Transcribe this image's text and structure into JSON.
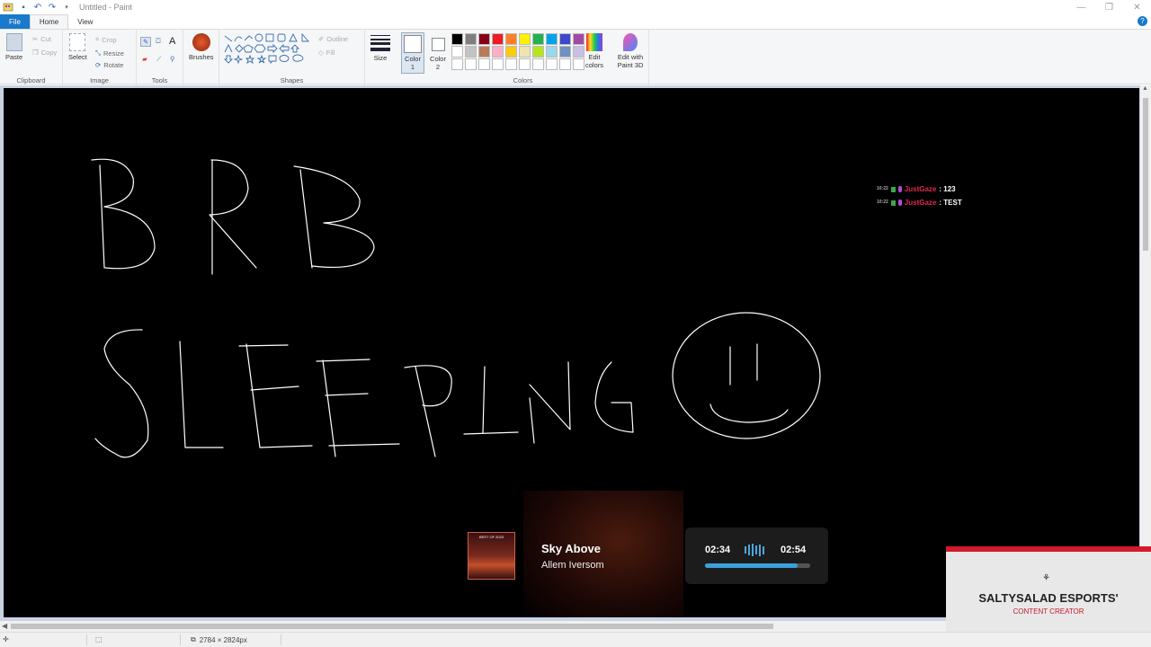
{
  "window": {
    "title": "Untitled - Paint",
    "controls": [
      "—",
      "❐",
      "✕"
    ]
  },
  "tabs": [
    "File",
    "Home",
    "View"
  ],
  "ribbon": {
    "clipboard": {
      "label": "Clipboard",
      "paste": "Paste",
      "cut": "Cut",
      "copy": "Copy"
    },
    "image": {
      "label": "Image",
      "select": "Select",
      "crop": "Crop",
      "resize": "Resize",
      "rotate": "Rotate"
    },
    "tools": {
      "label": "Tools"
    },
    "brushes": {
      "label": "Brushes"
    },
    "shapes": {
      "label": "Shapes",
      "outline": "Outline",
      "fill": "Fill"
    },
    "size": {
      "label": "Size"
    },
    "colors": {
      "label": "Colors",
      "color1": "Color 1",
      "color2": "Color 2",
      "edit_colors": "Edit colors",
      "paint3d": "Edit with Paint 3D"
    },
    "palette": [
      "#000000",
      "#7f7f7f",
      "#880015",
      "#ed1c24",
      "#ff7f27",
      "#fff200",
      "#22b14c",
      "#00a2e8",
      "#3f48cc",
      "#a349a4",
      "#ffffff",
      "#c3c3c3",
      "#b97a57",
      "#ffaec9",
      "#ffc90e",
      "#efe4b0",
      "#b5e61d",
      "#99d9ea",
      "#7092be",
      "#c8bfe7",
      "#ffffff",
      "#ffffff",
      "#ffffff",
      "#ffffff",
      "#ffffff",
      "#ffffff",
      "#ffffff",
      "#ffffff",
      "#ffffff",
      "#ffffff"
    ]
  },
  "chat": [
    {
      "time": "10:22",
      "user": "JustGaze",
      "message": ": 123"
    },
    {
      "time": "10:22",
      "user": "JustGaze",
      "message": ": TEST"
    }
  ],
  "music": {
    "album_label": "BEST OF 2023",
    "title": "Sky Above",
    "artist": "Allem Iversom",
    "elapsed": "02:34",
    "total": "02:54",
    "progress": 0.88
  },
  "esports": {
    "name": "SALTYSALAD ESPORTS'",
    "subtitle": "CONTENT CREATOR"
  },
  "status": {
    "dimensions": "2784 × 2824px"
  }
}
